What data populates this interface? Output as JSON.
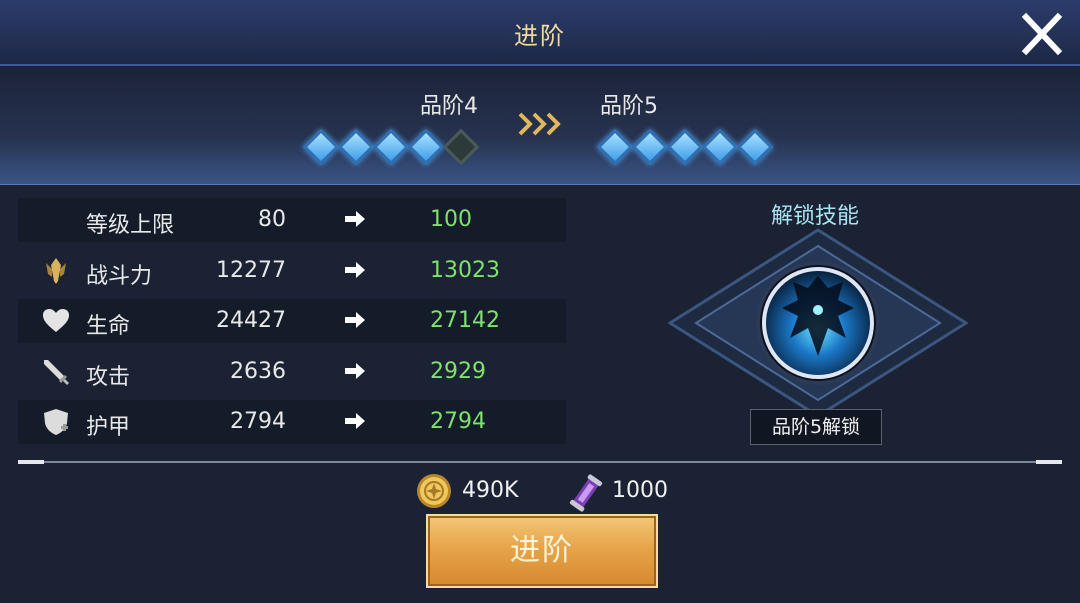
{
  "header": {
    "title": "进阶",
    "close_icon": "close-icon"
  },
  "rank": {
    "current_label": "品阶4",
    "next_label": "品阶5",
    "current_filled": 4,
    "current_total": 5,
    "next_filled": 5,
    "next_total": 5
  },
  "stats": [
    {
      "label": "等级上限",
      "old": "80",
      "new": "100",
      "icon": ""
    },
    {
      "label": "战斗力",
      "old": "12277",
      "new": "13023",
      "icon": "power-icon"
    },
    {
      "label": "生命",
      "old": "24427",
      "new": "27142",
      "icon": "heart-icon"
    },
    {
      "label": "攻击",
      "old": "2636",
      "new": "2929",
      "icon": "sword-icon"
    },
    {
      "label": "护甲",
      "old": "2794",
      "new": "2794",
      "icon": "shield-icon"
    }
  ],
  "skill": {
    "title": "解锁技能",
    "unlock_text": "品阶5解锁"
  },
  "cost": {
    "gold": "490K",
    "scroll": "1000"
  },
  "advance_button": "进阶",
  "colors": {
    "new_value": "#7fe26a",
    "title_gold": "#f1d99a",
    "skill_title": "#a9e4f2"
  }
}
